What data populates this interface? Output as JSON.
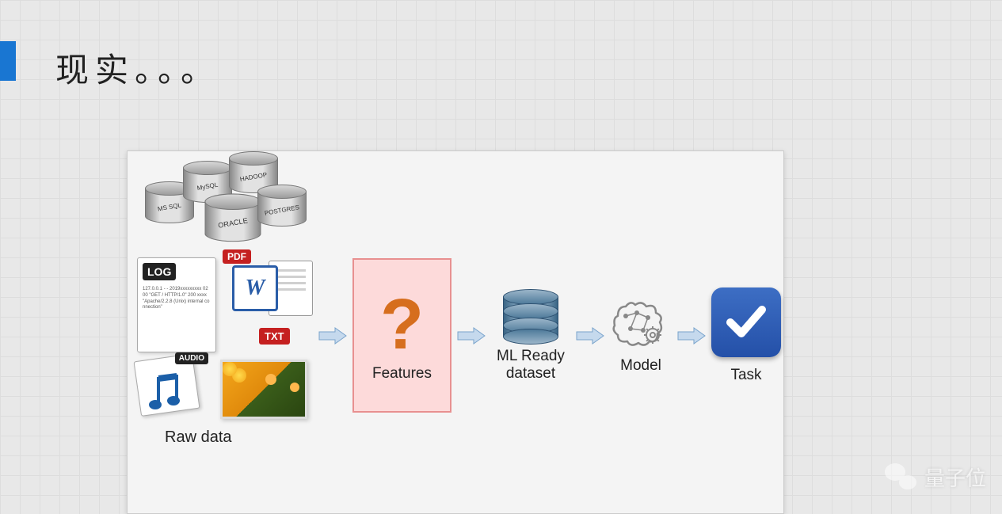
{
  "slide": {
    "title": "现实。。。"
  },
  "diagram": {
    "raw_data_label": "Raw data",
    "databases": [
      "MS SQL",
      "MySQL",
      "HADOOP",
      "ORACLE",
      "POSTGRES"
    ],
    "file_badges": {
      "log": "LOG",
      "pdf": "PDF",
      "word": "W",
      "txt": "TXT",
      "audio": "AUDIO"
    },
    "pipeline": {
      "features": {
        "symbol": "?",
        "label": "Features"
      },
      "dataset": {
        "label": "ML Ready dataset"
      },
      "model": {
        "label": "Model"
      },
      "task": {
        "label": "Task"
      }
    }
  },
  "watermark": "量子位"
}
